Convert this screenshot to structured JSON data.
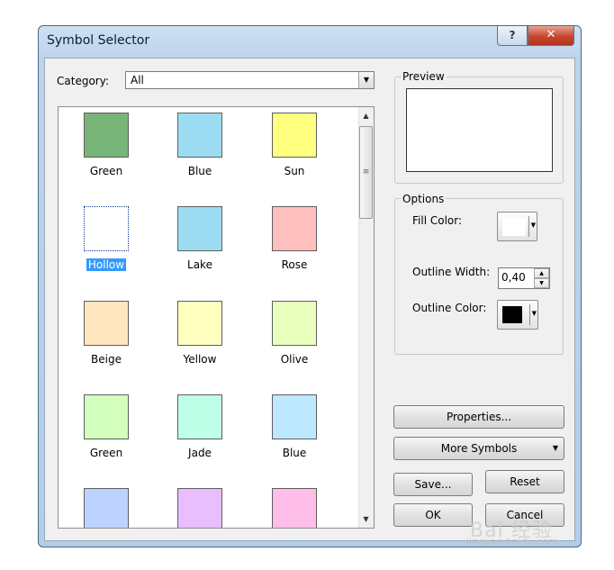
{
  "window": {
    "title": "Symbol Selector",
    "help_label": "?",
    "close_label": "✕"
  },
  "category": {
    "label": "Category:",
    "value": "All"
  },
  "symbols": [
    {
      "label": "Green",
      "color": "#79b578"
    },
    {
      "label": "Blue",
      "color": "#9cdcf2"
    },
    {
      "label": "Sun",
      "color": "#ffff80"
    },
    {
      "label": "Hollow",
      "color": "#ffffff",
      "selected": true
    },
    {
      "label": "Lake",
      "color": "#9cdcf2"
    },
    {
      "label": "Rose",
      "color": "#ffbfbf"
    },
    {
      "label": "Beige",
      "color": "#ffe6be"
    },
    {
      "label": "Yellow",
      "color": "#ffffbf"
    },
    {
      "label": "Olive",
      "color": "#e9ffbe"
    },
    {
      "label": "Green",
      "color": "#d3ffbe"
    },
    {
      "label": "Jade",
      "color": "#beffe8"
    },
    {
      "label": "Blue",
      "color": "#bee8ff"
    },
    {
      "label": "",
      "color": "#bed2ff"
    },
    {
      "label": "",
      "color": "#e8beff"
    },
    {
      "label": "",
      "color": "#ffbee8"
    }
  ],
  "preview": {
    "label": "Preview"
  },
  "options": {
    "label": "Options",
    "fill_color_label": "Fill Color:",
    "fill_color": "#ffffff",
    "outline_width_label": "Outline Width:",
    "outline_width": "0,40",
    "outline_color_label": "Outline Color:",
    "outline_color": "#000000"
  },
  "buttons": {
    "properties": "Properties...",
    "more_symbols": "More Symbols",
    "save": "Save...",
    "reset": "Reset",
    "ok": "OK",
    "cancel": "Cancel"
  },
  "watermark": {
    "main": "Bai 经验",
    "sub": "jingyan.baidu.com"
  }
}
